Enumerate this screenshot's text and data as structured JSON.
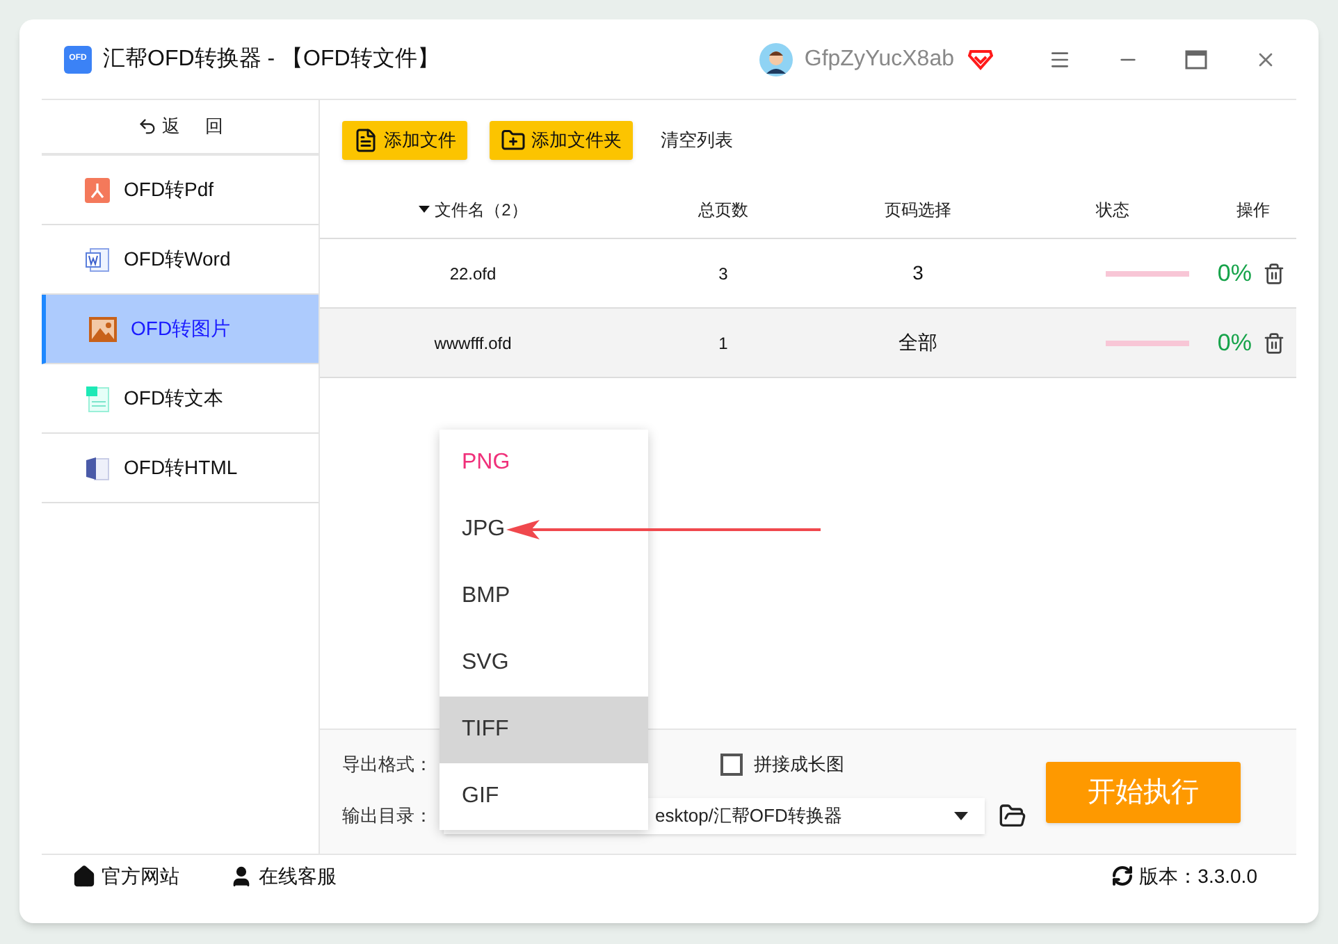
{
  "window": {
    "logo_text": "OFD",
    "title": "汇帮OFD转换器 - 【OFD转文件】",
    "user": "GfpZyYucX8ab"
  },
  "sidebar": {
    "back": "返 回",
    "items": [
      {
        "label": "OFD转Pdf",
        "kind": "pdf",
        "selected": false
      },
      {
        "label": "OFD转Word",
        "kind": "word",
        "selected": false
      },
      {
        "label": "OFD转图片",
        "kind": "image",
        "selected": true
      },
      {
        "label": "OFD转文本",
        "kind": "text",
        "selected": false
      },
      {
        "label": "OFD转HTML",
        "kind": "html",
        "selected": false
      }
    ]
  },
  "toolbar": [
    {
      "label": "添加文件",
      "kind": "file"
    },
    {
      "label": "添加文件夹",
      "kind": "folder"
    },
    {
      "label": "清空列表",
      "kind": "plain"
    }
  ],
  "table": {
    "columns": [
      "文件名（2）",
      "总页数",
      "页码选择",
      "状态",
      "操作"
    ],
    "rows": [
      {
        "name": "22.ofd",
        "pages": "3",
        "range": "3",
        "percent": "0%",
        "selected": false
      },
      {
        "name": "wwwfff.ofd",
        "pages": "1",
        "range": "全部",
        "percent": "0%",
        "selected": true
      }
    ]
  },
  "options": {
    "format_label": "导出格式：",
    "merge": {
      "label": "拼接成长图",
      "checked": false
    },
    "output_label": "输出目录：",
    "output_path": "esktop/汇帮OFD转换器",
    "start": "开始执行"
  },
  "dropdown": [
    {
      "label": "PNG",
      "selected": true,
      "hovered": false
    },
    {
      "label": "JPG",
      "selected": false,
      "hovered": false
    },
    {
      "label": "BMP",
      "selected": false,
      "hovered": false
    },
    {
      "label": "SVG",
      "selected": false,
      "hovered": false
    },
    {
      "label": "TIFF",
      "selected": false,
      "hovered": true
    },
    {
      "label": "GIF",
      "selected": false,
      "hovered": false
    }
  ],
  "footer": {
    "links": [
      {
        "label": "官方网站",
        "kind": "home"
      },
      {
        "label": "在线客服",
        "kind": "support"
      }
    ],
    "version": "版本：3.3.0.0"
  }
}
